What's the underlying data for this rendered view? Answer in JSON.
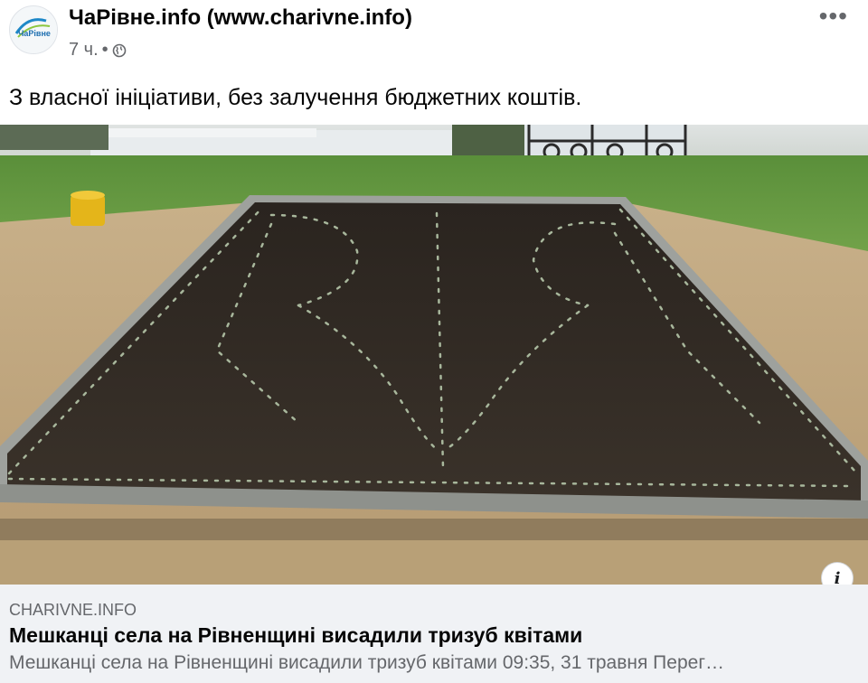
{
  "post": {
    "author": "ЧаРівне.info (www.charivne.info)",
    "avatar_text": "ЧаРівне",
    "time": "7 ч.",
    "separator": "•",
    "text": "З власної ініціативи, без залучення бюджетних коштів."
  },
  "link_preview": {
    "domain": "CHARIVNE.INFO",
    "title": "Мешканці села на Рівненщині висадили тризуб квітами",
    "description": "Мешканці села на Рівненщині висадили тризуб квітами 09:35, 31 травня Перег…"
  },
  "icons": {
    "privacy": "globe-icon",
    "menu": "more-horizontal-icon",
    "info": "info-icon"
  },
  "colors": {
    "meta_text": "#65676b",
    "card_bg": "#f0f2f5",
    "brand_blue": "#1e88c8"
  }
}
